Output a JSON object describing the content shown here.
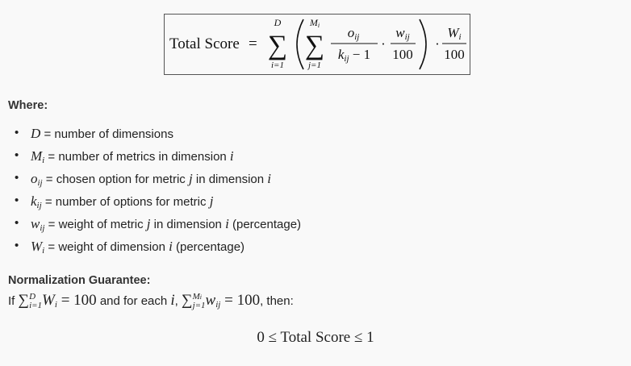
{
  "formula": {
    "lhs": "Total Score",
    "equals": "=",
    "outer_sum_upper": "D",
    "outer_sum_lower": "i=1",
    "inner_sum_upper": "M",
    "inner_sum_upper_sub": "i",
    "inner_sum_lower": "j=1",
    "frac1_num": "o",
    "frac1_num_sub": "ij",
    "frac1_den": "k",
    "frac1_den_sub": "ij",
    "frac1_den_tail": " − 1",
    "frac2_num": "w",
    "frac2_num_sub": "ij",
    "frac2_den": "100",
    "frac3_num": "W",
    "frac3_num_sub": "i",
    "frac3_den": "100",
    "dot": "·"
  },
  "where_heading": "Where:",
  "definitions": [
    {
      "sym": "D",
      "sub": "",
      "text": " = number of dimensions"
    },
    {
      "sym": "M",
      "sub": "i",
      "text": " = number of metrics in dimension ",
      "tail_var": "i",
      "tail_text": ""
    },
    {
      "sym": "o",
      "sub": "ij",
      "text": " = chosen option for metric ",
      "mid_var": "j",
      "mid_text": " in dimension ",
      "tail_var": "i"
    },
    {
      "sym": "k",
      "sub": "ij",
      "text": " = number of options for metric ",
      "tail_var": "j"
    },
    {
      "sym": "w",
      "sub": "ij",
      "text": " = weight of metric ",
      "mid_var": "j",
      "mid_text": " in dimension ",
      "tail_var": "i",
      "tail_text": " (percentage)"
    },
    {
      "sym": "W",
      "sub": "i",
      "text": " = weight of dimension ",
      "tail_var": "i",
      "tail_text": " (percentage)"
    }
  ],
  "normalization_heading": "Normalization Guarantee:",
  "condition": {
    "prefix": "If ",
    "sum1_upper": "D",
    "sum1_lower": "i=1",
    "sum1_term": "W",
    "sum1_term_sub": "i",
    "eq1": " = 100",
    "middle": " and for each ",
    "var": "i",
    "comma": ",",
    "sum2_upper": "M",
    "sum2_upper_sub": "i",
    "sum2_lower": "j=1",
    "sum2_term": "w",
    "sum2_term_sub": "ij",
    "eq2": " = 100",
    "suffix": ", then:"
  },
  "result": {
    "left": "0 ≤ ",
    "middle": "Total Score",
    "right": " ≤ 1"
  }
}
